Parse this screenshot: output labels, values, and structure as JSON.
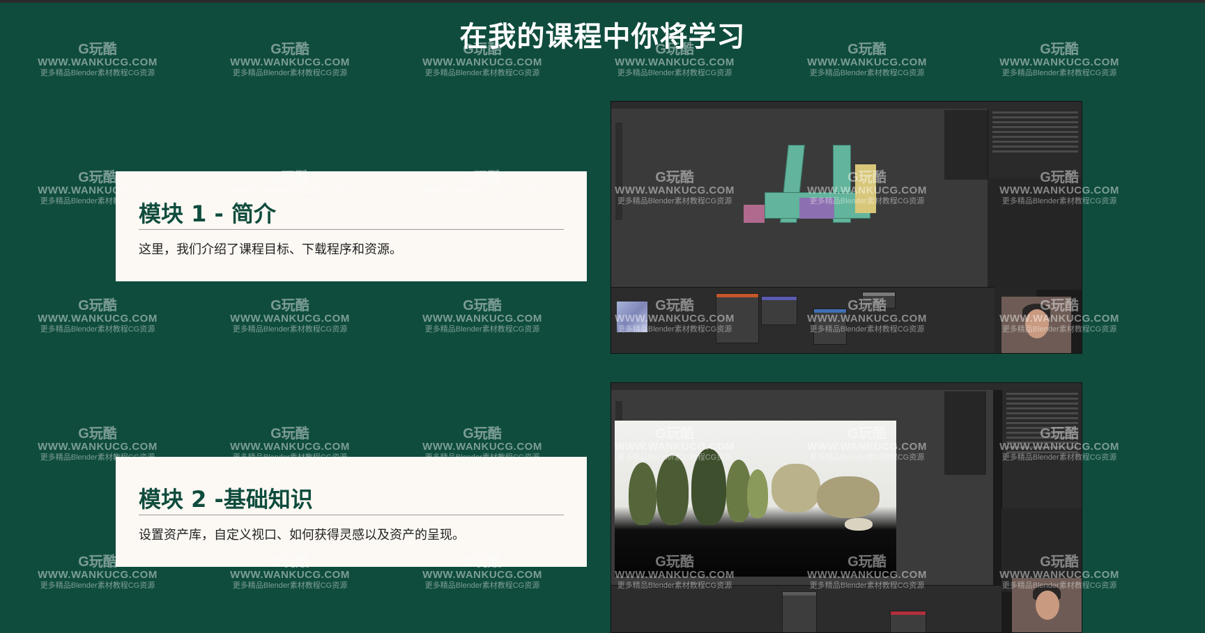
{
  "page": {
    "title": "在我的课程中你将学习",
    "background_color": "#0f4c3d",
    "accent_color": "#0f4c3d"
  },
  "modules": [
    {
      "heading": "模块 1 - 简介",
      "description": "这里，我们介绍了课程目标、下载程序和资源。"
    },
    {
      "heading": "模块 2 -基础知识",
      "description": "设置资产库，自定义视口、如何获得灵感以及资产的呈现。"
    }
  ],
  "watermark": {
    "logo": "G玩酷",
    "url": "WWW.WANKUCG.COM",
    "subtitle": "更多精品Blender素材教程CG资源"
  }
}
